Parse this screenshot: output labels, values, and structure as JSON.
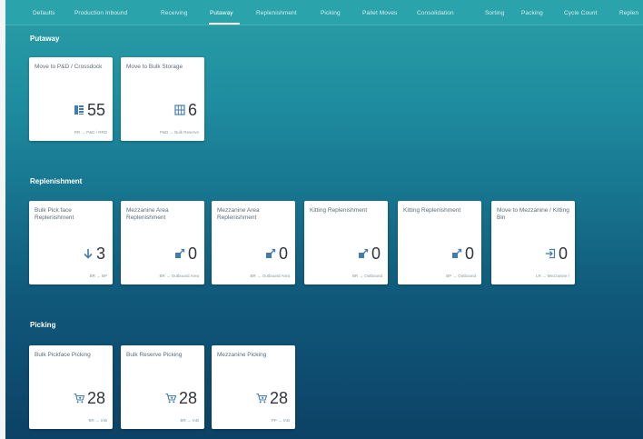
{
  "nav": {
    "tabs": [
      {
        "label": "Defaults"
      },
      {
        "label": "Production Inbound"
      },
      {
        "label": "Receiving"
      },
      {
        "label": "Putaway"
      },
      {
        "label": "Replenishment"
      },
      {
        "label": "Picking"
      },
      {
        "label": "Pallet Moves"
      },
      {
        "label": "Consolidation"
      },
      {
        "label": "Sorting"
      },
      {
        "label": "Packing"
      },
      {
        "label": "Cycle Count"
      },
      {
        "label": "Replen"
      }
    ],
    "active_tab": "Putaway"
  },
  "sections": {
    "putaway": {
      "title": "Putaway",
      "tiles": [
        {
          "title": "Move to P&D / Crossdock",
          "value": "55",
          "icon": "stack-icon",
          "footer": "RR → P&D / RRD"
        },
        {
          "title": "Move to Bulk Storage",
          "value": "6",
          "icon": "grid-icon",
          "footer": "P&D → Bulk Reserve"
        }
      ]
    },
    "replenishment": {
      "title": "Replenishment",
      "tiles": [
        {
          "title": "Bulk Pick face Replenishment",
          "value": "3",
          "icon": "arrow-down-icon",
          "footer": "BR → BP"
        },
        {
          "title": "Mezzanine Area Replenishment",
          "value": "0",
          "icon": "move-box-icon",
          "footer": "BR → Outbound Area"
        },
        {
          "title": "Mezzanine Area Replenishment",
          "value": "0",
          "icon": "move-box-icon",
          "footer": "BR → Outbound Area"
        },
        {
          "title": "Kitting Replenishment",
          "value": "0",
          "icon": "move-box-icon",
          "footer": "BR → Outbound"
        },
        {
          "title": "Kitting Replenishment",
          "value": "0",
          "icon": "move-box-icon",
          "footer": "BP → Outbound"
        },
        {
          "title": "Move to Mezzanine / Kitting Bin",
          "value": "0",
          "icon": "enter-icon",
          "footer": "LR → Mezzanine /"
        }
      ]
    },
    "picking": {
      "title": "Picking",
      "tiles": [
        {
          "title": "Bulk Pickface Picking",
          "value": "28",
          "icon": "cart-icon",
          "footer": "BR → IAB"
        },
        {
          "title": "Bulk Reserve Picking",
          "value": "28",
          "icon": "cart-icon",
          "footer": "BR → IAB"
        },
        {
          "title": "Mezzanine Picking",
          "value": "28",
          "icon": "cart-icon",
          "footer": "PP → IAB"
        }
      ]
    }
  },
  "colors": {
    "icon_blue": "#427cac",
    "tile_text": "#32363a"
  }
}
